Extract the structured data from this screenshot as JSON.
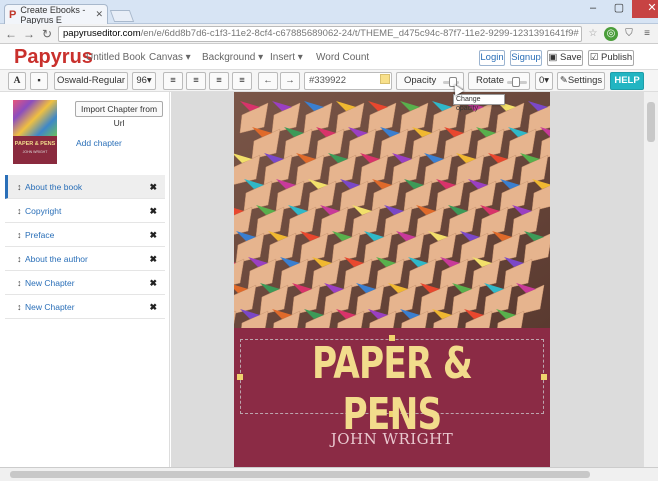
{
  "browser": {
    "tab_title": "Create Ebooks - Papyrus E",
    "url_host": "papyruseditor.com",
    "url_path": "/en/e/6dd8b7d6-c1f3-11e2-8cf4-c67885689062-24/t/THEME_d475c94c-87f7-11e2-9299-1231391641f9#"
  },
  "app": {
    "brand": "Papyrus",
    "doc_title": "Untitled Book",
    "menu": [
      "Canvas",
      "Background",
      "Insert",
      "Word Count"
    ],
    "login": "Login",
    "signup": "Signup",
    "save": "Save",
    "publish": "Publish"
  },
  "toolbar": {
    "font_family": "Oswald-Regular",
    "font_size": "96",
    "color_hex": "#339922",
    "opacity_label": "Opacity",
    "opacity_tooltip": "Change opacity",
    "rotate_label": "Rotate",
    "rotate_value": "0",
    "settings": "Settings",
    "help": "HELP"
  },
  "sidebar": {
    "import_button": "Import Chapter from Url",
    "add_chapter": "Add chapter",
    "thumb_title": "PAPER & PENS",
    "thumb_author": "JOHN WRIGHT",
    "chapters": [
      {
        "label": "About the book",
        "active": true
      },
      {
        "label": "Copyright",
        "active": false
      },
      {
        "label": "Preface",
        "active": false
      },
      {
        "label": "About the author",
        "active": false
      },
      {
        "label": "New Chapter",
        "active": false
      },
      {
        "label": "New Chapter",
        "active": false
      }
    ]
  },
  "cover": {
    "title": "PAPER & PENS",
    "author": "JOHN WRIGHT",
    "background_color": "#8b2b45",
    "title_color": "#f2dc8c"
  }
}
